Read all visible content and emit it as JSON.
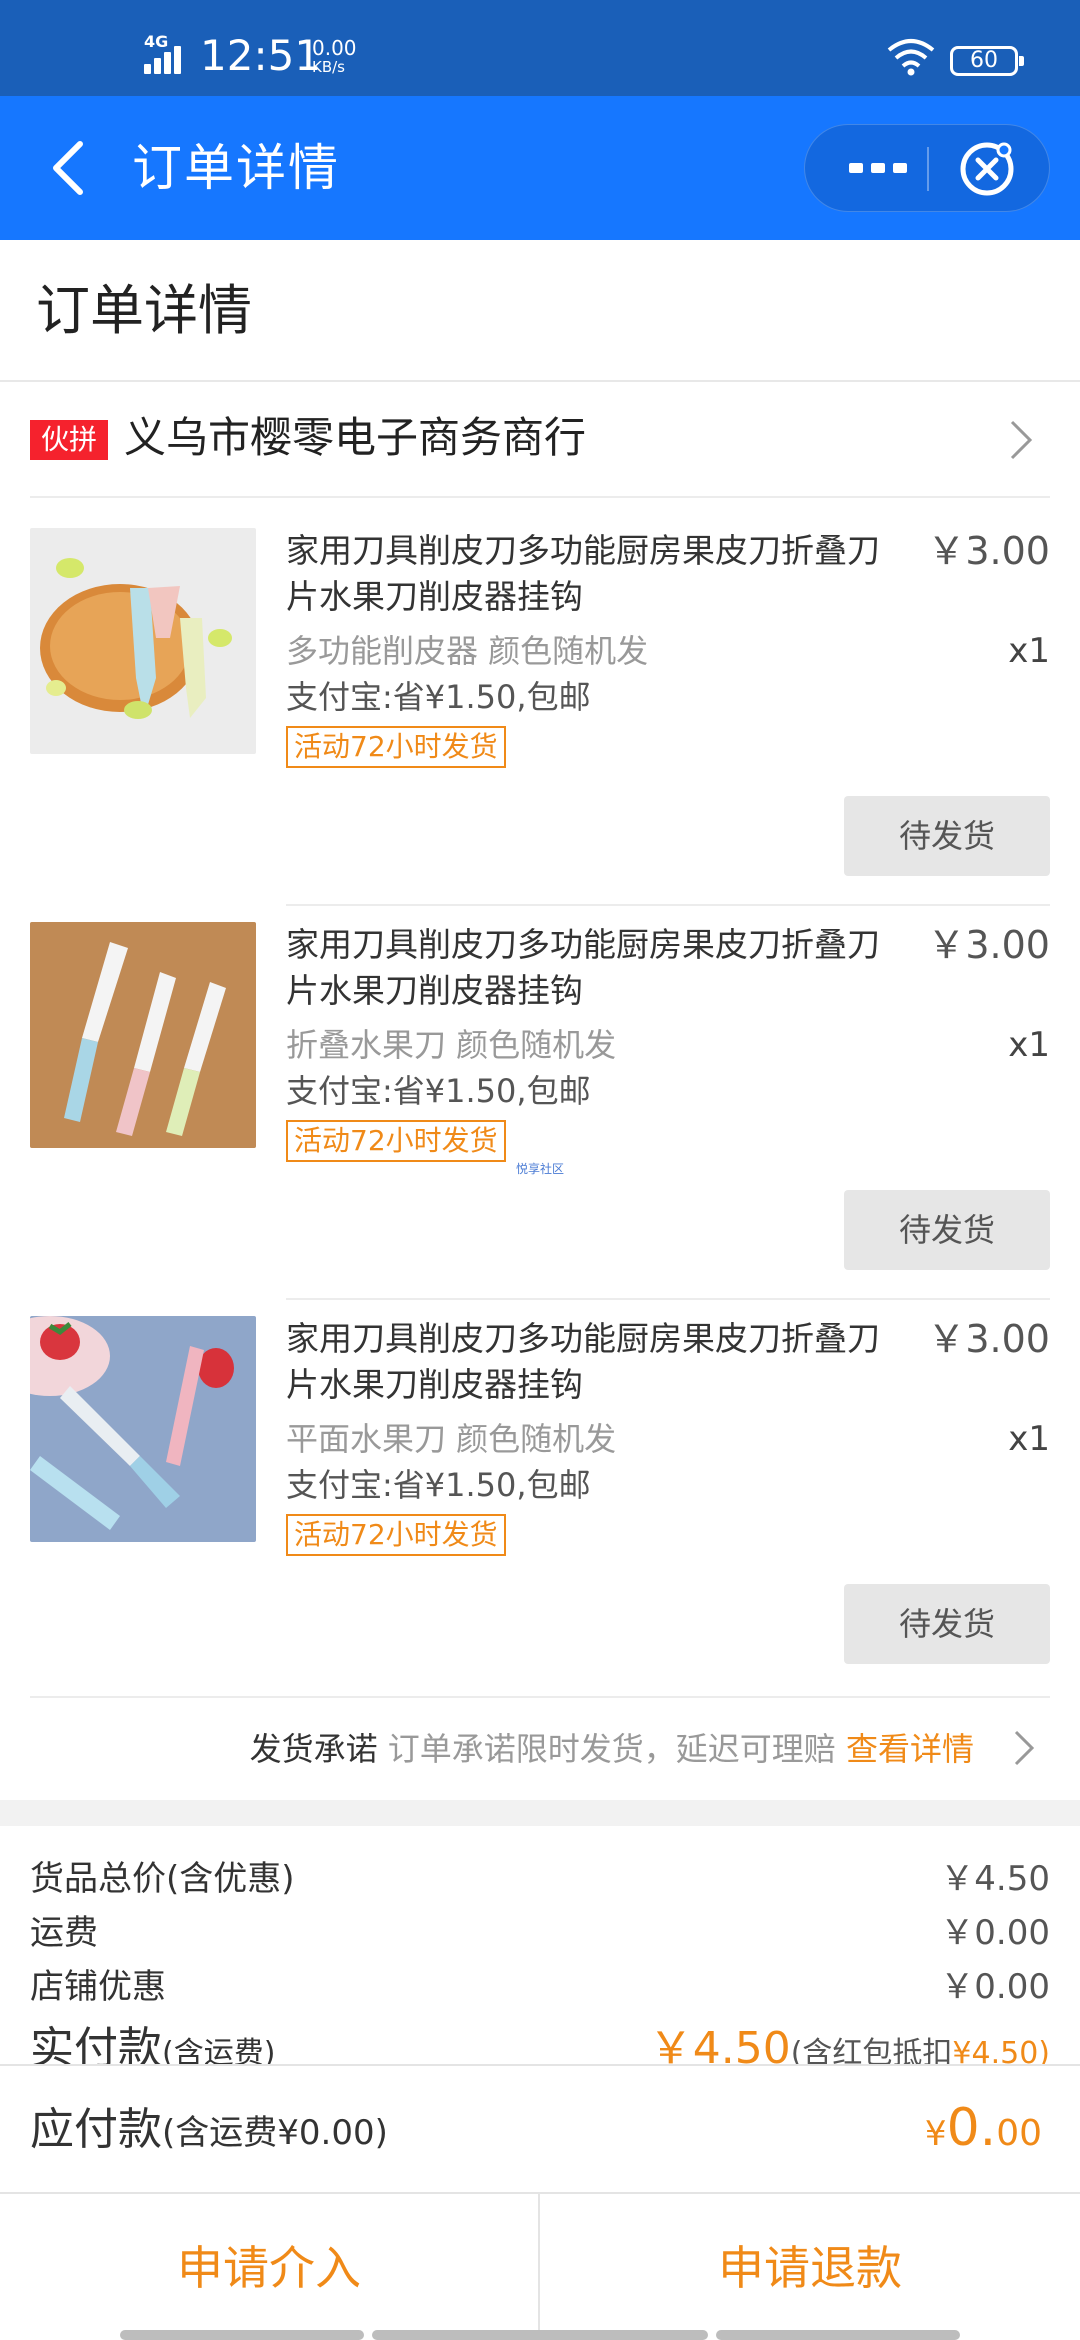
{
  "status_bar": {
    "network": "4G",
    "time": "12:51",
    "speed_value": "0.00",
    "speed_unit": "KB/s",
    "battery": "60"
  },
  "nav": {
    "title": "订单详情"
  },
  "header": {
    "title": "订单详情"
  },
  "shop": {
    "badge": "伙拼",
    "name": "义乌市樱零电子商务商行"
  },
  "items": [
    {
      "title": "家用刀具削皮刀多功能厨房果皮刀折叠刀片水果刀削皮器挂钩",
      "price": "￥3.00",
      "spec": "多功能削皮器 颜色随机发",
      "qty": "x1",
      "promo": "支付宝:省¥1.50,包邮",
      "tag": "活动72小时发货",
      "status": "待发货",
      "image": "peeler-product-image"
    },
    {
      "title": "家用刀具削皮刀多功能厨房果皮刀折叠刀片水果刀削皮器挂钩",
      "price": "￥3.00",
      "spec": "折叠水果刀 颜色随机发",
      "qty": "x1",
      "promo": "支付宝:省¥1.50,包邮",
      "tag": "活动72小时发货",
      "status": "待发货",
      "image": "folding-knife-product-image"
    },
    {
      "title": "家用刀具削皮刀多功能厨房果皮刀折叠刀片水果刀削皮器挂钩",
      "price": "￥3.00",
      "spec": "平面水果刀 颜色随机发",
      "qty": "x1",
      "promo": "支付宝:省¥1.50,包邮",
      "tag": "活动72小时发货",
      "status": "待发货",
      "image": "fruit-knife-product-image"
    }
  ],
  "watermark": "悦享社区",
  "promise": {
    "label": "发货承诺",
    "desc": "订单承诺限时发货，延迟可理赔",
    "link": "查看详情"
  },
  "summary": {
    "goods_label": "货品总价(含优惠)",
    "goods_value": "￥4.50",
    "shipping_label": "运费",
    "shipping_value": "￥0.00",
    "discount_label": "店铺优惠",
    "discount_value": "￥0.00",
    "paid_label": "实付款",
    "paid_label_note": "(含运费)",
    "paid_value": "￥4.50",
    "paid_note_a": "(含红包抵扣",
    "paid_note_b": "¥4.50)"
  },
  "payable": {
    "label": "应付款",
    "note": "(含运费¥0.00)",
    "currency": "¥",
    "amount_int": "0.",
    "amount_dec": "00"
  },
  "actions": {
    "intervene": "申请介入",
    "refund": "申请退款"
  },
  "colors": {
    "status_bar": "#1a5fb8",
    "nav_bar": "#1677ff",
    "accent_orange": "#f08a18",
    "badge_red": "#f5222d"
  }
}
